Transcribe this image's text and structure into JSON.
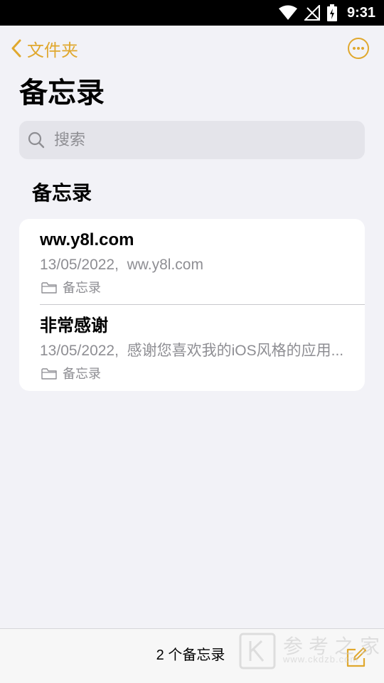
{
  "status_bar": {
    "time": "9:31"
  },
  "navbar": {
    "back_label": "文件夹"
  },
  "page": {
    "title": "备忘录"
  },
  "search": {
    "placeholder": "搜索"
  },
  "section": {
    "title": "备忘录"
  },
  "notes": [
    {
      "title": "ww.y8l.com",
      "date": "13/05/2022",
      "preview": "ww.y8l.com",
      "folder": "备忘录"
    },
    {
      "title": "非常感谢",
      "date": "13/05/2022",
      "preview": "感谢您喜欢我的iOS风格的应用...",
      "folder": "备忘录"
    }
  ],
  "toolbar": {
    "count_label": "2 个备忘录"
  },
  "watermark": {
    "text": "参考之家",
    "url": "www.ckdzb.com"
  },
  "colors": {
    "accent": "#e0a82e",
    "background": "#f2f2f7",
    "secondary_text": "#8e8e93"
  }
}
